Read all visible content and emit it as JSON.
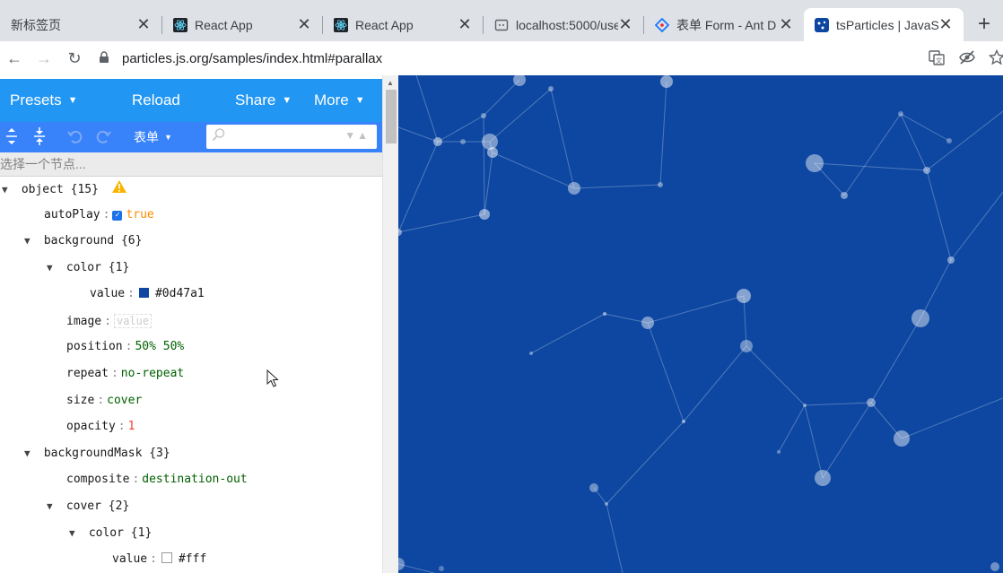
{
  "tabs": [
    {
      "title": "新标签页",
      "icon": "new-tab-icon"
    },
    {
      "title": "React App",
      "icon": "react-logo-icon"
    },
    {
      "title": "React App",
      "icon": "react-logo-icon"
    },
    {
      "title": "localhost:5000/use",
      "icon": "localhost-icon"
    },
    {
      "title": "表单 Form - Ant D",
      "icon": "ant-design-icon"
    },
    {
      "title": "tsParticles | JavaSc",
      "icon": "tsparticles-icon"
    }
  ],
  "tab_close": "✕",
  "new_tab": "+",
  "toolbar": {
    "back": "←",
    "forward": "→",
    "reload": "↻",
    "url": "particles.js.org/samples/index.html#parallax"
  },
  "menu": {
    "presets": "Presets",
    "reload": "Reload",
    "share": "Share",
    "more": "More"
  },
  "json_toolbar": {
    "mode": "表单"
  },
  "navbar_hint": "选择一个节点...",
  "tree": {
    "root": {
      "key": "object",
      "count": "{15}"
    },
    "autoPlay": {
      "key": "autoPlay",
      "value": "true"
    },
    "background": {
      "key": "background",
      "count": "{6}"
    },
    "color": {
      "key": "color",
      "count": "{1}"
    },
    "color_value": {
      "key": "value",
      "value": "#0d47a1"
    },
    "image": {
      "key": "image",
      "placeholder": "value"
    },
    "position": {
      "key": "position",
      "value": "50% 50%"
    },
    "repeat": {
      "key": "repeat",
      "value": "no-repeat"
    },
    "size": {
      "key": "size",
      "value": "cover"
    },
    "opacity": {
      "key": "opacity",
      "value": "1"
    },
    "backgroundMask": {
      "key": "backgroundMask",
      "count": "{3}"
    },
    "composite": {
      "key": "composite",
      "value": "destination-out"
    },
    "cover": {
      "key": "cover",
      "count": "{2}"
    },
    "cover_color": {
      "key": "color",
      "count": "{1}"
    },
    "cover_color_value": {
      "key": "value",
      "value": "#fff"
    }
  },
  "colors": {
    "canvas_bg": "#0d47a1",
    "menu_bar": "#2196f3",
    "json_bar": "#3883fa",
    "mask_swatch": "#ffffff"
  }
}
